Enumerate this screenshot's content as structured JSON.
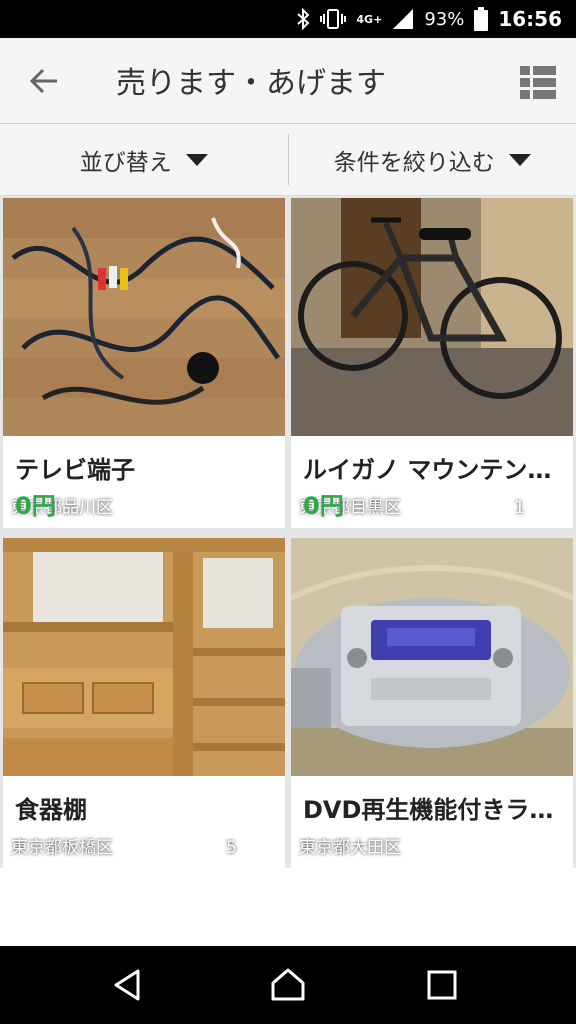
{
  "status_bar": {
    "network": "4G+",
    "battery_percent": "93%",
    "time": "16:56"
  },
  "header": {
    "title": "売ります・あげます"
  },
  "filters": {
    "sort_label": "並び替え",
    "filter_label": "条件を絞り込む"
  },
  "listings": [
    {
      "area": "東京都品川区",
      "favorites": "",
      "name": "テレビ端子",
      "price": "0円"
    },
    {
      "area": "東京都目黒区",
      "favorites": "1",
      "name": "ルイガノ マウンテン…",
      "price": "0円"
    },
    {
      "area": "東京都板橋区",
      "favorites": "5",
      "name": "食器棚",
      "price": ""
    },
    {
      "area": "東京都大田区",
      "favorites": "",
      "name": "DVD再生機能付きラ…",
      "price": ""
    }
  ],
  "colors": {
    "price_green": "#2ea84a",
    "header_bg": "#f5f5f5"
  },
  "icons": [
    "bluetooth-icon",
    "vibrate-icon",
    "signal-icon",
    "battery-icon",
    "back-arrow-icon",
    "list-view-icon",
    "caret-down-icon",
    "star-icon",
    "nav-back-icon",
    "nav-home-icon",
    "nav-recents-icon"
  ]
}
